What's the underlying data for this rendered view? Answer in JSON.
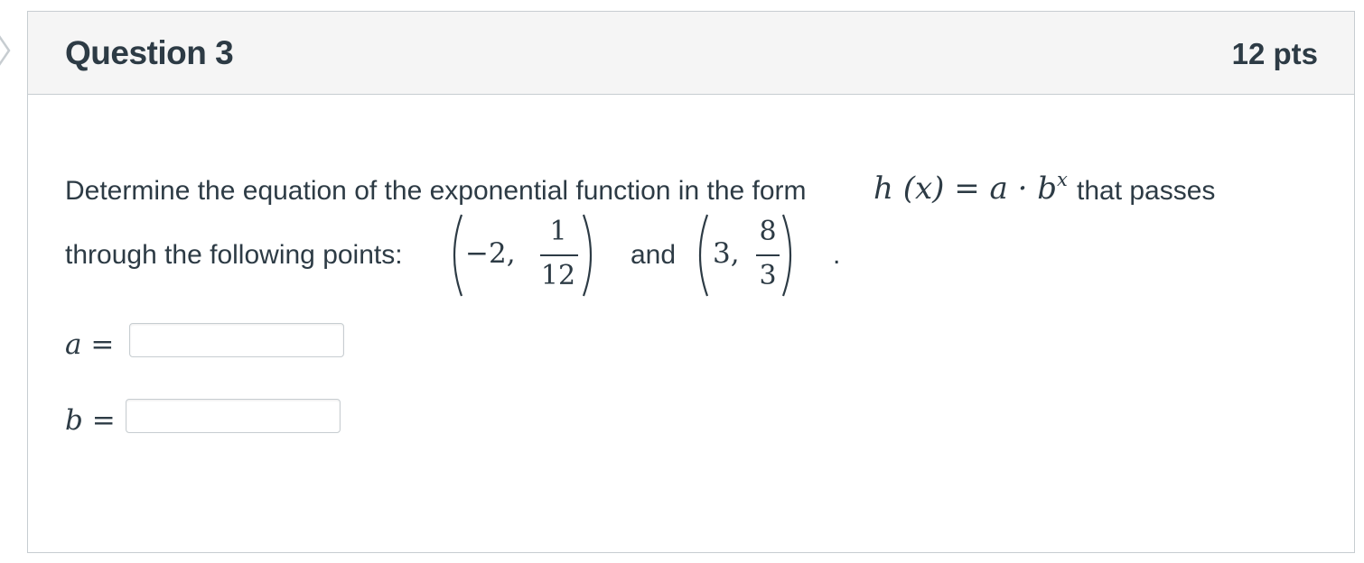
{
  "nav": {
    "icon": "chevron-right-icon"
  },
  "question": {
    "title": "Question 3",
    "points": "12 pts",
    "prompt_part1": "Determine the equation of the exponential function in the form",
    "formula_lhs": "h (x) = a · b",
    "formula_exp": "x",
    "prompt_part2": "that passes",
    "prompt_line2": "through the following points:",
    "point1": {
      "x": "−2,",
      "num": "1",
      "den": "12"
    },
    "conjunction": "and",
    "point2": {
      "x": "3,",
      "num": "8",
      "den": "3"
    },
    "end_period": ".",
    "fields": [
      {
        "label": "a =",
        "value": "",
        "placeholder": ""
      },
      {
        "label": "b =",
        "value": "",
        "placeholder": ""
      }
    ]
  },
  "colors": {
    "text": "#2d3b45",
    "border": "#c7cdd1",
    "header_bg": "#f5f5f5",
    "chevron": "#c7cdd1"
  }
}
